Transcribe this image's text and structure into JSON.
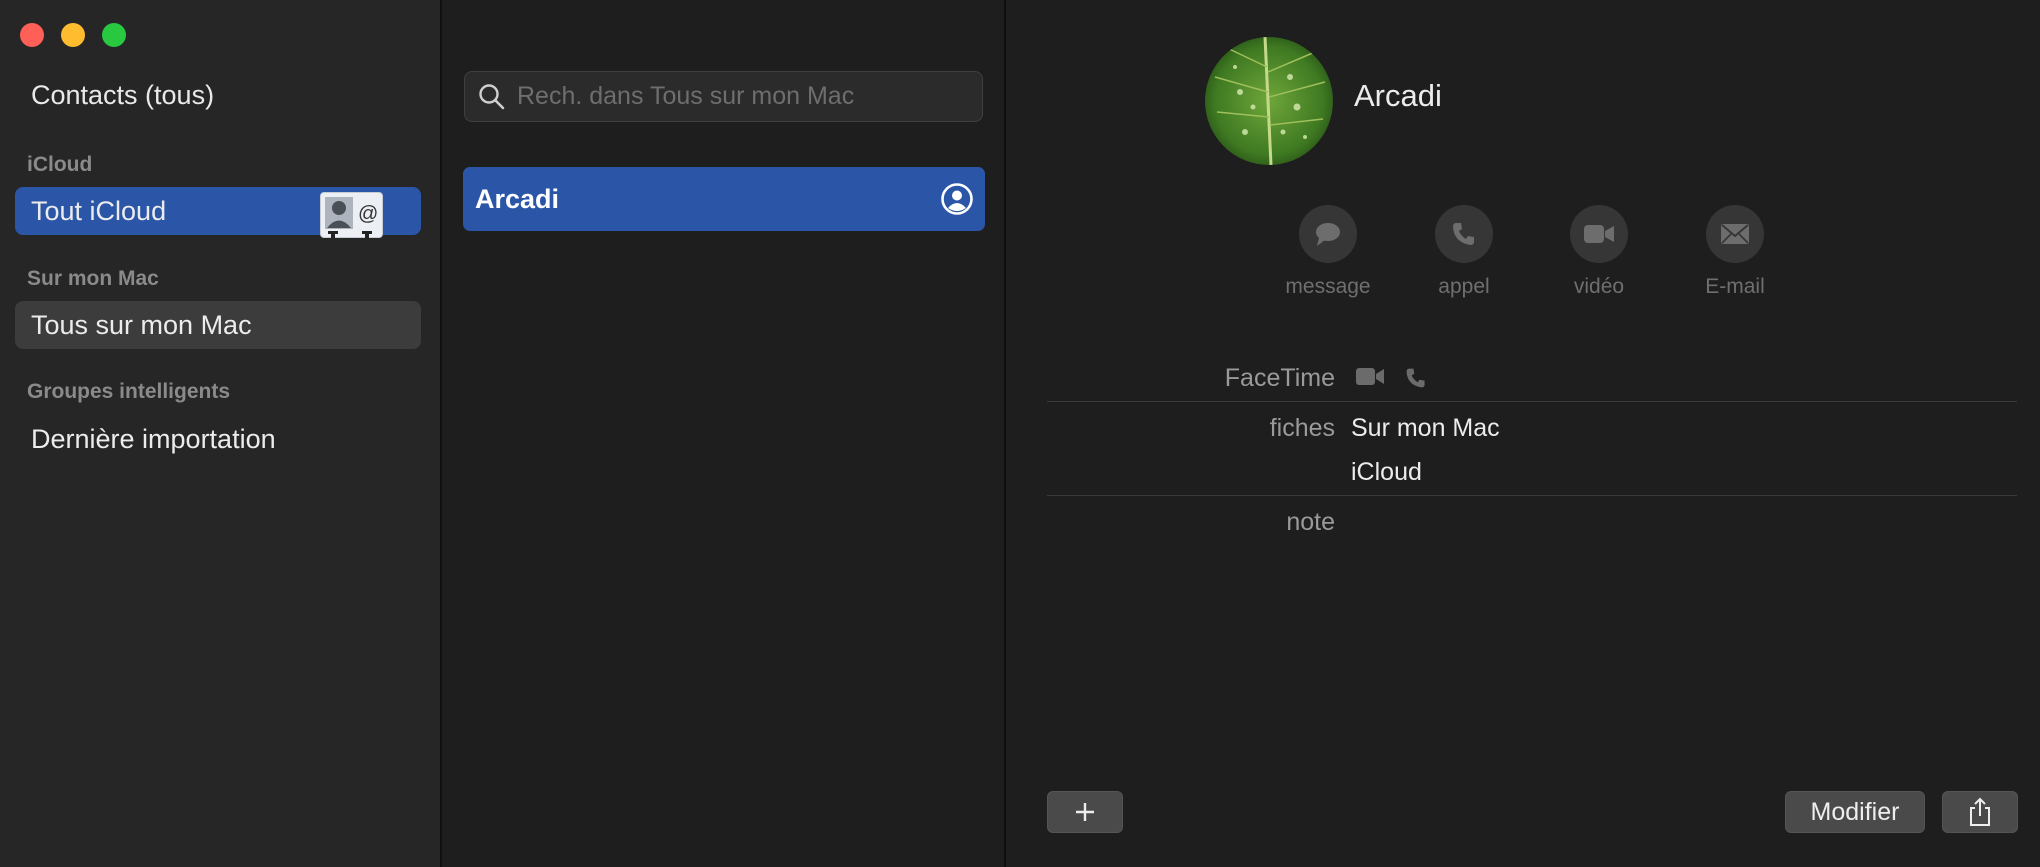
{
  "sidebar": {
    "all_contacts": "Contacts (tous)",
    "sections": [
      {
        "header": "iCloud",
        "items": [
          "Tout iCloud"
        ]
      },
      {
        "header": "Sur mon Mac",
        "items": [
          "Tous sur mon Mac"
        ]
      },
      {
        "header": "Groupes intelligents",
        "items": [
          "Dernière importation"
        ]
      }
    ]
  },
  "list": {
    "search_placeholder": "Rech. dans Tous sur mon Mac",
    "contacts": [
      "Arcadi"
    ]
  },
  "detail": {
    "name": "Arcadi",
    "actions": [
      "message",
      "appel",
      "vidéo",
      "E-mail"
    ],
    "fields": {
      "facetime_label": "FaceTime",
      "cards_label": "fiches",
      "cards": [
        "Sur mon Mac",
        "iCloud"
      ],
      "note_label": "note"
    },
    "buttons": {
      "edit": "Modifier"
    }
  },
  "colors": {
    "selection": "#2b56a8",
    "close": "#fe5f57",
    "minimize": "#febc2e",
    "zoom": "#28c840"
  }
}
